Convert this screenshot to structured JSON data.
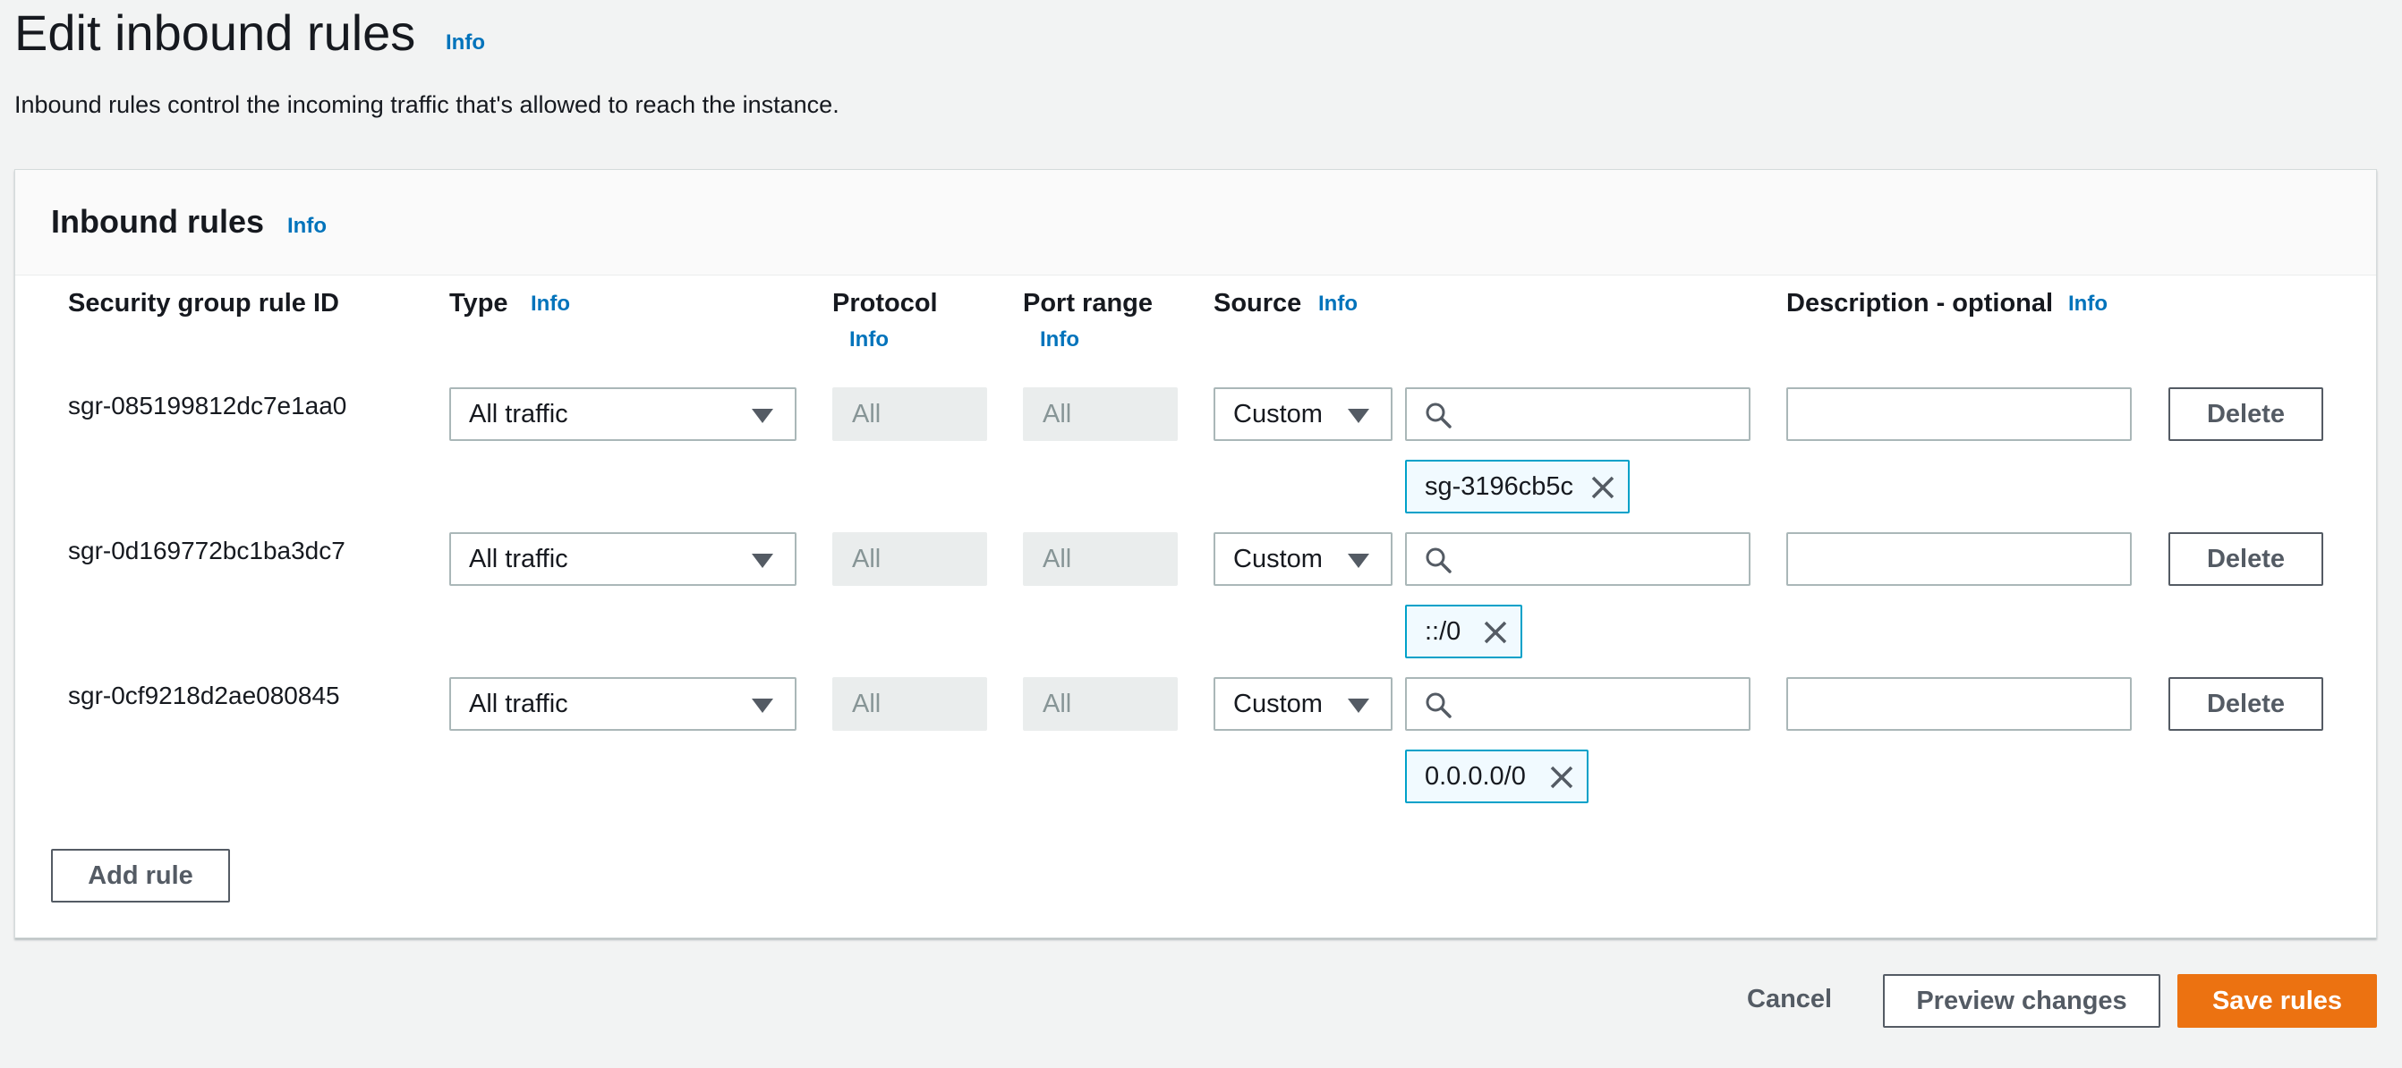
{
  "page": {
    "title": "Edit inbound rules",
    "info": "Info",
    "description": "Inbound rules control the incoming traffic that's allowed to reach the instance."
  },
  "panel": {
    "title": "Inbound rules",
    "info": "Info"
  },
  "columns": {
    "rule_id": "Security group rule ID",
    "type": "Type",
    "type_info": "Info",
    "protocol": "Protocol",
    "protocol_info": "Info",
    "port_range": "Port range",
    "port_range_info": "Info",
    "source": "Source",
    "source_info": "Info",
    "description": "Description - optional",
    "description_info": "Info"
  },
  "rules": [
    {
      "id": "sgr-085199812dc7e1aa0",
      "type": "All traffic",
      "protocol": "All",
      "port_range": "All",
      "source_type": "Custom",
      "search_value": "",
      "token": "sg-3196cb5c",
      "description": "",
      "delete_label": "Delete"
    },
    {
      "id": "sgr-0d169772bc1ba3dc7",
      "type": "All traffic",
      "protocol": "All",
      "port_range": "All",
      "source_type": "Custom",
      "search_value": "",
      "token": "::/0",
      "description": "",
      "delete_label": "Delete"
    },
    {
      "id": "sgr-0cf9218d2ae080845",
      "type": "All traffic",
      "protocol": "All",
      "port_range": "All",
      "source_type": "Custom",
      "search_value": "",
      "token": "0.0.0.0/0",
      "description": "",
      "delete_label": "Delete"
    }
  ],
  "actions": {
    "add_rule": "Add rule",
    "cancel": "Cancel",
    "preview": "Preview changes",
    "save": "Save rules"
  },
  "colors": {
    "link": "#0073bb",
    "primary": "#ec7211",
    "token_border": "#00a1c9",
    "background": "#f2f3f3"
  }
}
